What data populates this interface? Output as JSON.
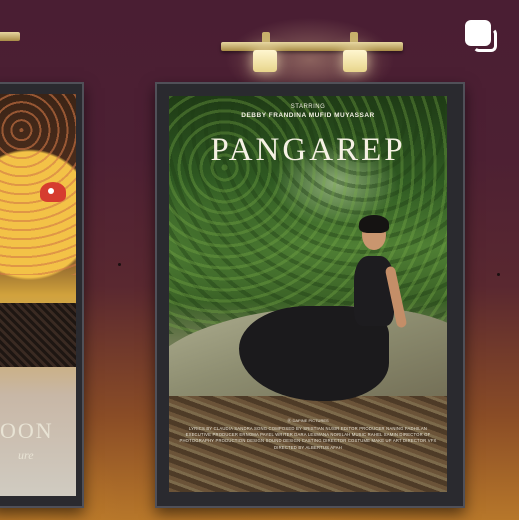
{
  "gallery": {
    "left_poster": {
      "title": "OON",
      "subtitle": "ure"
    },
    "right_poster": {
      "starring_label": "STARRING",
      "cast": "DEBBY FRANDINA   MUFID MUYASSAR",
      "title": "PANGAREP",
      "studio_mark": "Ⓡ DAPINE PICTURES",
      "billing_text": "LYRICS BY CLAUDIA SANDRA  SONG COMPOSED BY SRISTIAN NUSIR  EDITOR PRODUCER NANING FADHILAN  EXECUTIVE PRODUCER ERNOMA PAYEL  WRITER DARA LESMANA NORILAH  MUSIC RAHEL SAMIN  DIRECTOR OF PHOTOGRAPHY  PRODUCTION DESIGN  SOUND DESIGN  CASTING DIRECTOR  COSTUME  MAKE UP  ART DIRECTOR  VFX  DIRECTED BY ALBERTUS AFAH"
    },
    "multi_image_icon": "multiple-images-icon",
    "colors": {
      "wall": "#4a1e33",
      "floor_glow": "#b7772a",
      "lamp": "#e6d6a0",
      "frame": "#2a2a2f"
    }
  }
}
